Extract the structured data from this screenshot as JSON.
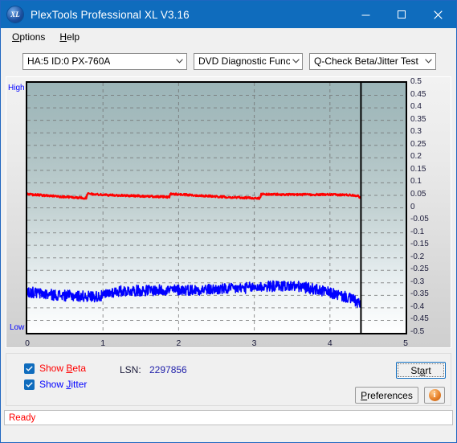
{
  "window": {
    "title": "PlexTools Professional XL V3.16",
    "icon": "xl-app-icon",
    "icon_text": "XL",
    "minimize_label": "─",
    "maximize_label": "□",
    "close_label": "✕"
  },
  "menubar": {
    "items": [
      {
        "label": "Options",
        "accel": "O"
      },
      {
        "label": "Help",
        "accel": "H"
      }
    ]
  },
  "toolbar": {
    "drive_select": "HA:5 ID:0  PX-760A",
    "function_select": "DVD Diagnostic Functions",
    "test_select": "Q-Check Beta/Jitter Test"
  },
  "chart_axis": {
    "high_label": "High",
    "low_label": "Low"
  },
  "controls": {
    "show_beta": {
      "label_prefix": "Show ",
      "label_accel": "B",
      "label_suffix": "eta",
      "checked": true
    },
    "show_jitter": {
      "label_prefix": "Show ",
      "label_accel": "J",
      "label_suffix": "itter",
      "checked": true
    },
    "lsn_label": "LSN:",
    "lsn_value": "2297856",
    "start_button": {
      "prefix": "St",
      "accel": "a",
      "suffix": "rt"
    },
    "preferences_button": {
      "prefix": "",
      "accel": "P",
      "suffix": "references"
    },
    "info_button": "i"
  },
  "statusbar": {
    "text": "Ready"
  },
  "colors": {
    "accent": "#0f6cbd",
    "beta": "#ff0000",
    "jitter": "#0000ff",
    "status": "#ff0000",
    "plot_top": "#9cb5b8",
    "plot_bottom": "#ffffff"
  },
  "chart_data": {
    "type": "line",
    "title": "Q-Check Beta/Jitter Test",
    "xlabel": "",
    "ylabel": "",
    "xlim": [
      0,
      5
    ],
    "ylim": [
      -0.5,
      0.5
    ],
    "grid": true,
    "legend": "none",
    "x_ticks": [
      0,
      1,
      2,
      3,
      4,
      5
    ],
    "y_ticks": [
      0.5,
      0.45,
      0.4,
      0.35,
      0.3,
      0.25,
      0.2,
      0.15,
      0.1,
      0.05,
      0,
      -0.05,
      -0.1,
      -0.15,
      -0.2,
      -0.25,
      -0.3,
      -0.35,
      -0.4,
      -0.45,
      -0.5
    ],
    "annotations": [
      {
        "type": "vline",
        "x": 4.41,
        "color": "#000000",
        "label": "write-end marker"
      },
      {
        "type": "text",
        "text": "High",
        "position": "top-left-outside",
        "color": "#0000ff"
      },
      {
        "type": "text",
        "text": "Low",
        "position": "bottom-left-outside",
        "color": "#0000ff"
      }
    ],
    "series": [
      {
        "name": "Beta",
        "color": "#ff0000",
        "noise": 0.004,
        "x": [
          0.0,
          0.1,
          0.2,
          0.3,
          0.4,
          0.5,
          0.6,
          0.7,
          0.78,
          0.79,
          0.9,
          1.0,
          1.1,
          1.2,
          1.3,
          1.4,
          1.5,
          1.6,
          1.7,
          1.8,
          1.88,
          1.89,
          2.0,
          2.1,
          2.2,
          2.3,
          2.4,
          2.5,
          2.6,
          2.7,
          2.8,
          2.9,
          3.0,
          3.08,
          3.09,
          3.2,
          3.3,
          3.4,
          3.5,
          3.6,
          3.7,
          3.8,
          3.9,
          4.0,
          4.1,
          4.2,
          4.3,
          4.36,
          4.41
        ],
        "y": [
          0.054,
          0.052,
          0.05,
          0.048,
          0.046,
          0.044,
          0.042,
          0.04,
          0.039,
          0.056,
          0.054,
          0.052,
          0.051,
          0.05,
          0.049,
          0.048,
          0.047,
          0.046,
          0.045,
          0.044,
          0.043,
          0.056,
          0.054,
          0.052,
          0.05,
          0.049,
          0.047,
          0.045,
          0.044,
          0.042,
          0.041,
          0.04,
          0.039,
          0.038,
          0.055,
          0.054,
          0.054,
          0.053,
          0.053,
          0.053,
          0.053,
          0.053,
          0.053,
          0.053,
          0.052,
          0.052,
          0.051,
          0.049,
          0.04
        ]
      },
      {
        "name": "Jitter",
        "color": "#0000ff",
        "noise": 0.022,
        "x": [
          0.0,
          0.1,
          0.2,
          0.3,
          0.4,
          0.5,
          0.6,
          0.7,
          0.8,
          0.9,
          1.0,
          1.1,
          1.2,
          1.3,
          1.4,
          1.5,
          1.6,
          1.7,
          1.8,
          1.9,
          2.0,
          2.1,
          2.2,
          2.3,
          2.4,
          2.5,
          2.6,
          2.7,
          2.8,
          2.9,
          3.0,
          3.1,
          3.2,
          3.3,
          3.4,
          3.5,
          3.6,
          3.7,
          3.8,
          3.9,
          4.0,
          4.1,
          4.2,
          4.3,
          4.36,
          4.41
        ],
        "y": [
          -0.335,
          -0.34,
          -0.344,
          -0.347,
          -0.349,
          -0.351,
          -0.352,
          -0.353,
          -0.354,
          -0.354,
          -0.353,
          -0.338,
          -0.334,
          -0.332,
          -0.331,
          -0.331,
          -0.33,
          -0.33,
          -0.329,
          -0.329,
          -0.328,
          -0.328,
          -0.328,
          -0.327,
          -0.327,
          -0.326,
          -0.325,
          -0.324,
          -0.322,
          -0.32,
          -0.318,
          -0.316,
          -0.314,
          -0.313,
          -0.312,
          -0.313,
          -0.316,
          -0.32,
          -0.326,
          -0.333,
          -0.34,
          -0.348,
          -0.356,
          -0.366,
          -0.378,
          -0.39
        ]
      }
    ]
  }
}
